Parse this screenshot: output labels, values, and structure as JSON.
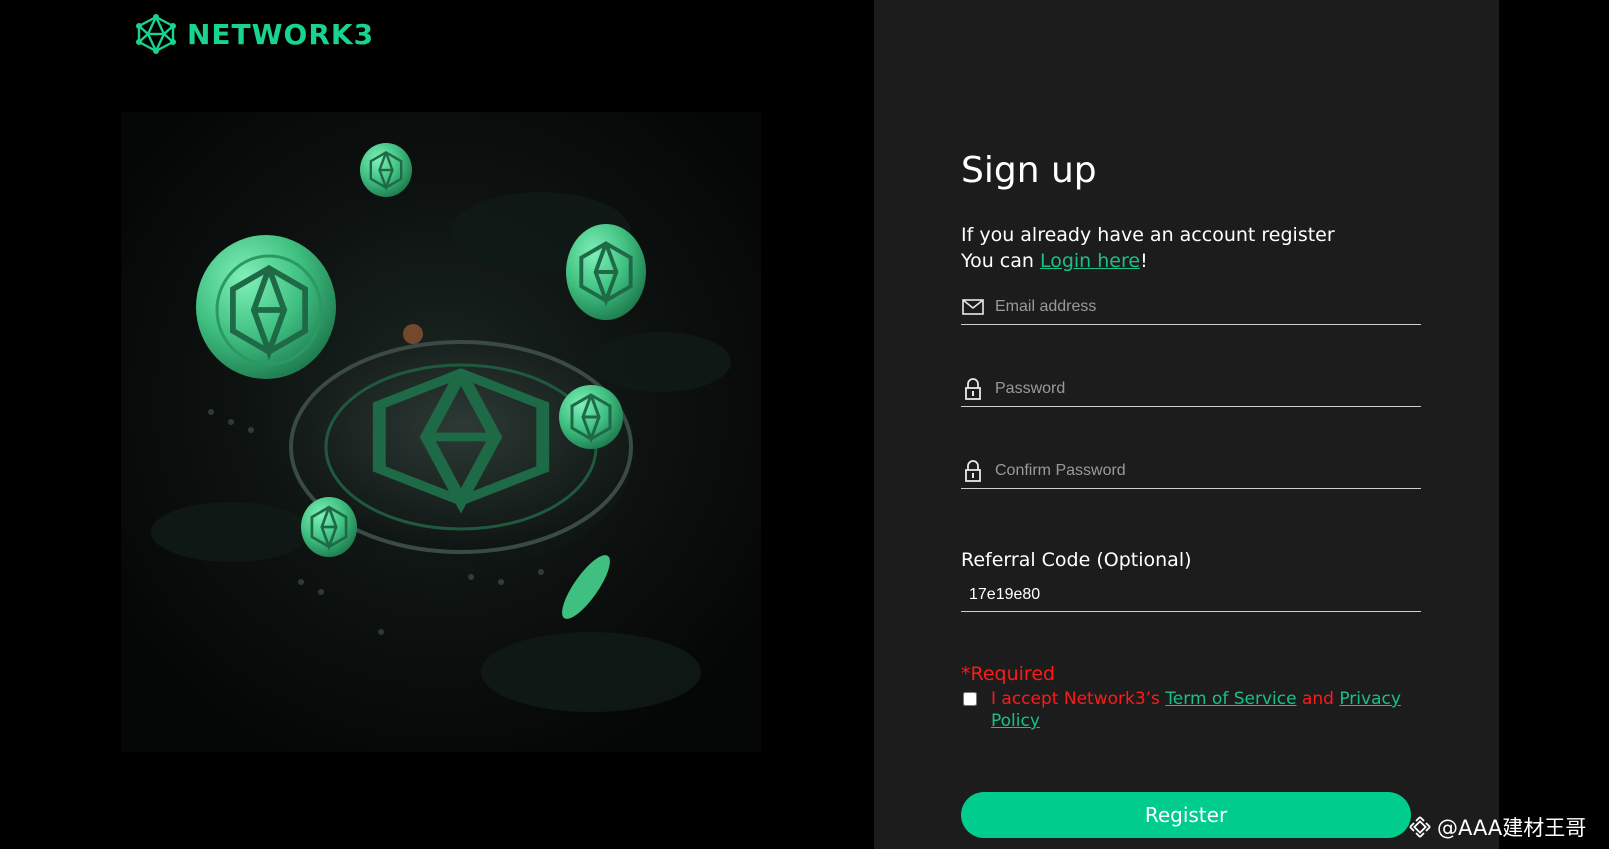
{
  "brand": {
    "name": "NETWORK3",
    "accent": "#19d48d"
  },
  "signup": {
    "title": "Sign up",
    "line1": "If you already have an account register",
    "line2_prefix": "You can ",
    "login_link": "Login here",
    "line2_suffix": "!",
    "email_placeholder": "Email address",
    "password_placeholder": "Password",
    "confirm_placeholder": "Confirm Password",
    "referral_label": "Referral Code (Optional)",
    "referral_value": "17e19e80",
    "required_text": "*Required",
    "accept_prefix": "I accept Network3’s ",
    "tos_link": "Term of Service",
    "and_text": " and ",
    "privacy_link": "Privacy Policy",
    "register_label": "Register"
  },
  "icons": [
    "envelope-icon",
    "lock-icon",
    "lock-icon"
  ],
  "watermark": {
    "text": "@AAA建材王哥"
  },
  "colors": {
    "panel": "#1c1c1c",
    "button": "#00cc8e",
    "link": "#19c08a",
    "error": "#ff1a1a"
  }
}
